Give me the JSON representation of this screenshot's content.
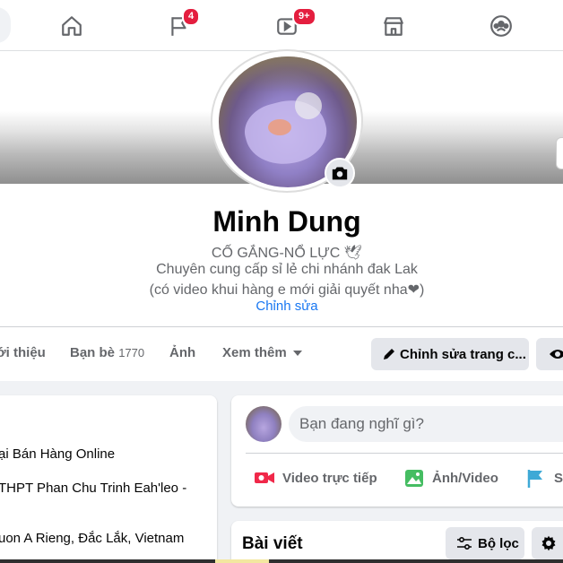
{
  "nav": {
    "tabs": [
      {
        "name": "home",
        "icon": "home-icon",
        "badge": ""
      },
      {
        "name": "pages",
        "icon": "flag-icon",
        "badge": "4"
      },
      {
        "name": "watch",
        "icon": "video-icon",
        "badge": "9+"
      },
      {
        "name": "marketplace",
        "icon": "store-icon",
        "badge": ""
      },
      {
        "name": "groups",
        "icon": "groups-icon",
        "badge": ""
      }
    ],
    "badge_color": "#e41e3f",
    "icon_color": "#65676b"
  },
  "profile": {
    "name": "Minh Dung",
    "bio_line1": "CỐ GẮNG-NỔ LỰC 🕊",
    "bio_line2": "Chuyên cung cấp sỉ lẻ chi nhánh đak Lak",
    "bio_line3": "(có video khui hàng e mới giải quyết nha❤)",
    "edit_bio": "Chỉnh sửa"
  },
  "profile_tabs": {
    "about": "ới thiệu",
    "friends": "Bạn bè",
    "friends_count": "1770",
    "photos": "Ảnh",
    "more": "Xem thêm"
  },
  "actions": {
    "edit_profile": "Chỉnh sửa trang c..."
  },
  "intro": {
    "work": "ại Bán Hàng Online",
    "school": "THPT Phan Chu Trinh Eah'leo -",
    "location": "uon A Rieng, Đắc Lắk, Vietnam"
  },
  "composer": {
    "placeholder": "Bạn đang nghĩ gì?",
    "live_video": "Video trực tiếp",
    "photo_video": "Ảnh/Video",
    "life_event": "Sự"
  },
  "posts": {
    "title": "Bài viết",
    "filter": "Bộ lọc"
  },
  "colors": {
    "accent": "#1877f2",
    "live_red": "#f02849",
    "photo_green": "#45bd62",
    "flag_teal": "#3ea9d6"
  }
}
